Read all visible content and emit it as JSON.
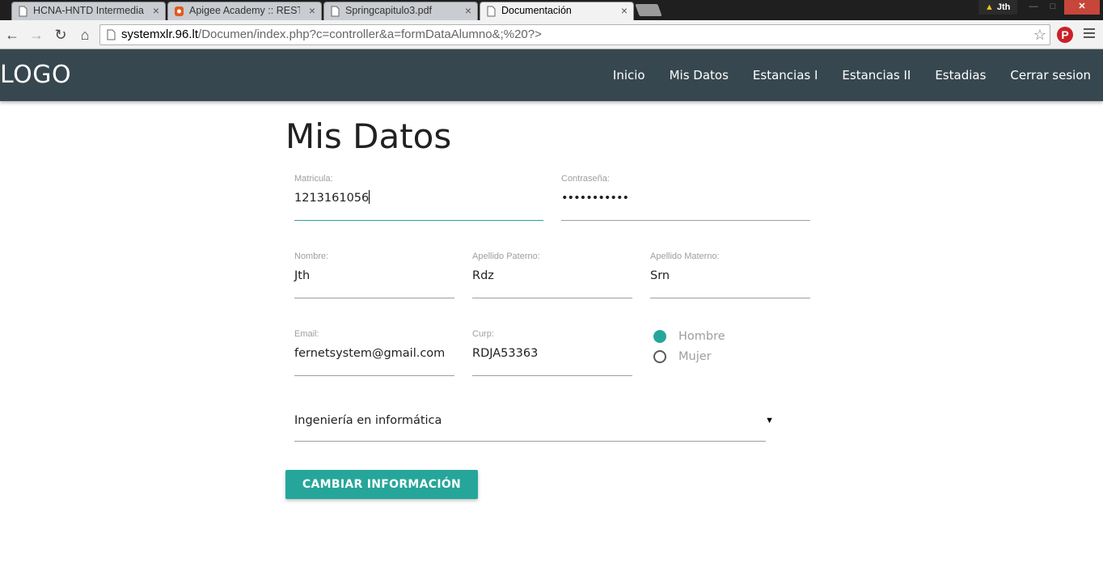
{
  "browser": {
    "tabs": [
      {
        "title": "HCNA-HNTD Intermediate",
        "icon": "page-icon",
        "active": false
      },
      {
        "title": "Apigee Academy :: REST ar",
        "icon": "apigee-icon",
        "active": false
      },
      {
        "title": "Springcapitulo3.pdf",
        "icon": "page-icon",
        "active": false
      },
      {
        "title": "Documentación",
        "icon": "page-icon",
        "active": true
      }
    ],
    "close_glyph": "×",
    "profile_name": "Jth",
    "address": {
      "host": "systemxlr.96.lt",
      "path": "/Documen/index.php?c=controller&a=formDataAlumno&;%20?>"
    }
  },
  "nav": {
    "logo": "LOGO",
    "links": [
      "Inicio",
      "Mis Datos",
      "Estancias I",
      "Estancias II",
      "Estadias",
      "Cerrar sesion"
    ]
  },
  "form": {
    "title": "Mis Datos",
    "matricula": {
      "label": "Matricula:",
      "value": "1213161056"
    },
    "password": {
      "label": "Contraseña:",
      "value": "•••••••••••"
    },
    "nombre": {
      "label": "Nombre:",
      "value": "Jth"
    },
    "apellido_paterno": {
      "label": "Apellido Paterno:",
      "value": "Rdz"
    },
    "apellido_materno": {
      "label": "Apellido Materno:",
      "value": "Srn"
    },
    "email": {
      "label": "Email:",
      "value": "fernetsystem@gmail.com"
    },
    "curp": {
      "label": "Curp:",
      "value": "RDJA53363"
    },
    "gender": {
      "options": [
        "Hombre",
        "Mujer"
      ],
      "selected": "Hombre"
    },
    "carrera": {
      "selected": "Ingeniería en informática"
    },
    "submit_label": "CAMBIAR INFORMACIÓN"
  },
  "colors": {
    "accent": "#26a69a",
    "navbar": "#37474f"
  }
}
